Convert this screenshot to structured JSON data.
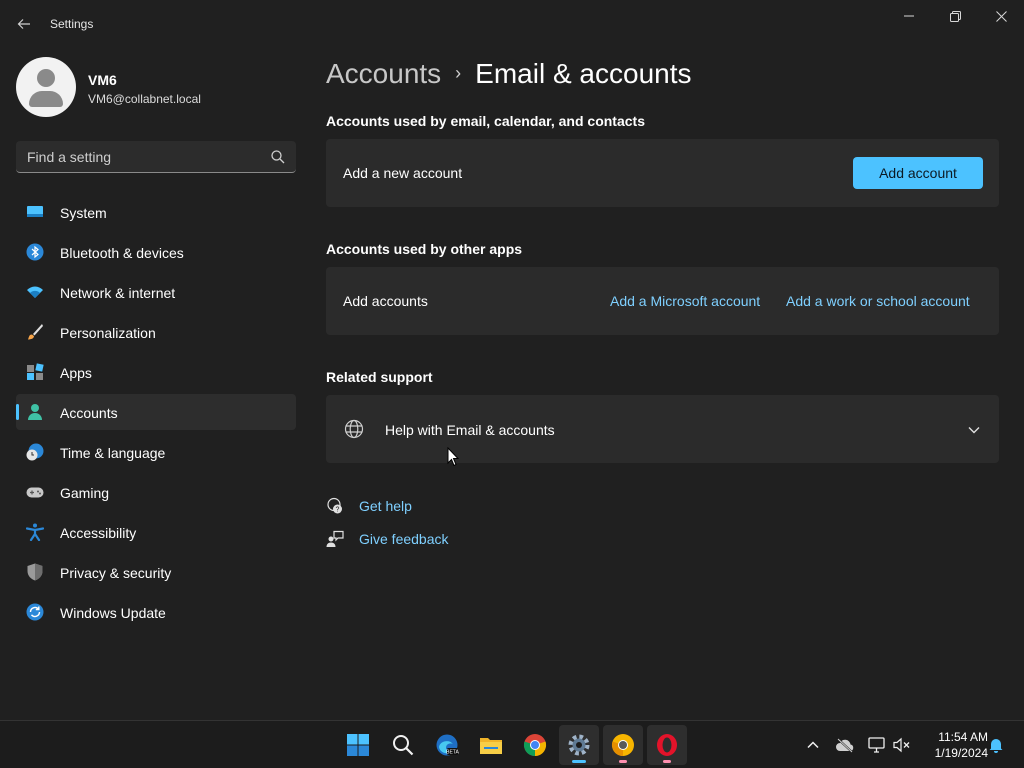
{
  "window": {
    "title": "Settings",
    "controls": {
      "minimize": "—",
      "maximize": "❐",
      "close": "✕"
    }
  },
  "profile": {
    "name": "VM6",
    "email": "VM6@collabnet.local"
  },
  "search": {
    "placeholder": "Find a setting",
    "value": ""
  },
  "nav": {
    "items": [
      {
        "label": "System",
        "icon": "system-icon"
      },
      {
        "label": "Bluetooth & devices",
        "icon": "bluetooth-icon"
      },
      {
        "label": "Network & internet",
        "icon": "wifi-icon"
      },
      {
        "label": "Personalization",
        "icon": "brush-icon"
      },
      {
        "label": "Apps",
        "icon": "apps-icon"
      },
      {
        "label": "Accounts",
        "icon": "accounts-icon",
        "active": true
      },
      {
        "label": "Time & language",
        "icon": "time-language-icon"
      },
      {
        "label": "Gaming",
        "icon": "gamepad-icon"
      },
      {
        "label": "Accessibility",
        "icon": "accessibility-icon"
      },
      {
        "label": "Privacy & security",
        "icon": "shield-icon"
      },
      {
        "label": "Windows Update",
        "icon": "update-icon"
      }
    ]
  },
  "breadcrumb": {
    "parent": "Accounts",
    "separator": "›",
    "current": "Email & accounts"
  },
  "sections": {
    "email_calendar": {
      "title": "Accounts used by email, calendar, and contacts",
      "row_label": "Add a new account",
      "button_label": "Add account"
    },
    "other_apps": {
      "title": "Accounts used by other apps",
      "row_label": "Add accounts",
      "link_microsoft": "Add a Microsoft account",
      "link_work": "Add a work or school account"
    },
    "related": {
      "title": "Related support",
      "expander_label": "Help with Email & accounts"
    }
  },
  "help_links": {
    "get_help": "Get help",
    "give_feedback": "Give feedback"
  },
  "taskbar": {
    "apps": [
      "start-icon",
      "search-icon",
      "edge-beta-icon",
      "file-explorer-icon",
      "chrome-icon",
      "settings-icon",
      "chrome-canary-icon",
      "opera-icon"
    ],
    "clock_time": "11:54 AM",
    "clock_date": "1/19/2024"
  },
  "colors": {
    "accent": "#4cc2ff",
    "background": "#202020",
    "card": "#2b2b2b",
    "link": "#7fd0ff"
  }
}
